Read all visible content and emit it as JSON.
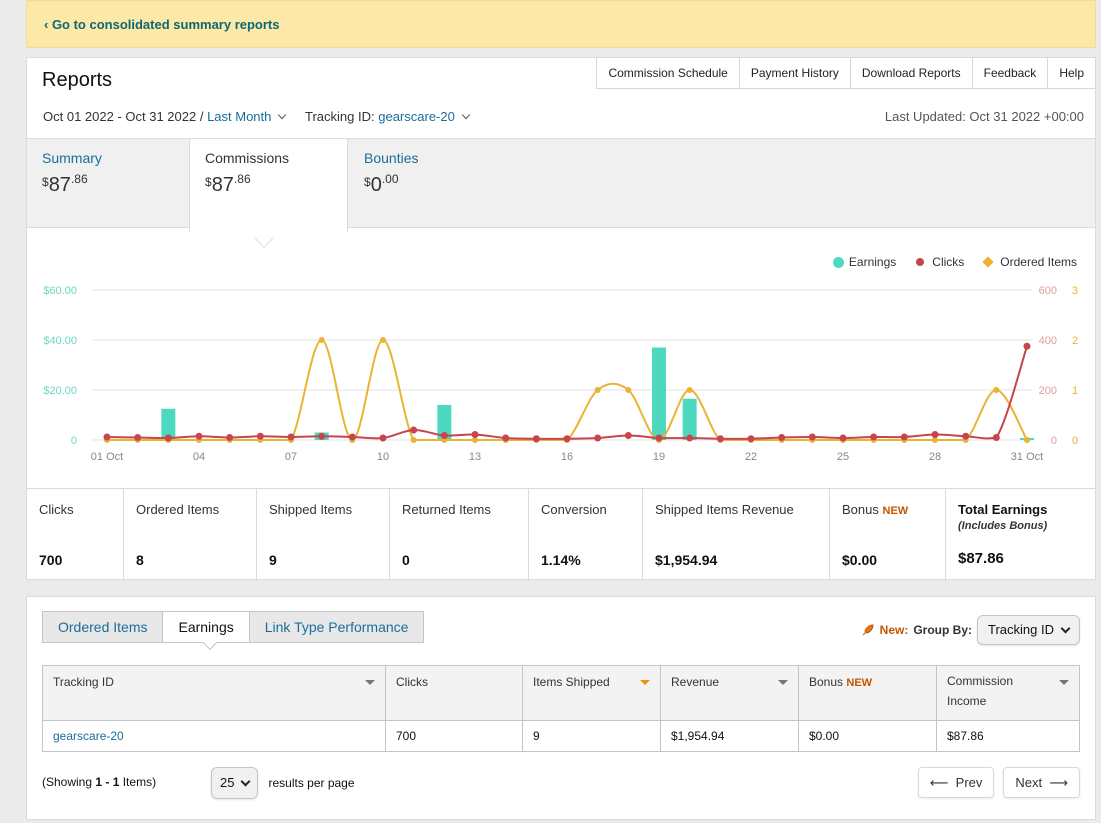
{
  "banner": {
    "link": "‹ Go to consolidated summary reports"
  },
  "header": {
    "title": "Reports",
    "links": [
      "Commission Schedule",
      "Payment History",
      "Download Reports",
      "Feedback",
      "Help"
    ]
  },
  "filters": {
    "date_range": "Oct 01 2022 - Oct 31 2022 /",
    "period": "Last Month",
    "tracking_label": "Tracking ID:",
    "tracking_value": "gearscare-20",
    "last_updated": "Last Updated: Oct 31 2022 +00:00"
  },
  "tabs": [
    {
      "label": "Summary",
      "currency": "$",
      "whole": "87",
      "cents": ".86"
    },
    {
      "label": "Commissions",
      "currency": "$",
      "whole": "87",
      "cents": ".86"
    },
    {
      "label": "Bounties",
      "currency": "$",
      "whole": "0",
      "cents": ".00"
    }
  ],
  "legend": [
    "Earnings",
    "Clicks",
    "Ordered Items"
  ],
  "colors": {
    "earnings": "#4dd9c0",
    "clicks": "#c7454d",
    "ordered": "#eab334",
    "link": "#1a6d9a",
    "new": "#c45500"
  },
  "chart_data": {
    "type": "bar",
    "x": [
      "01 Oct",
      "02",
      "03",
      "04",
      "05",
      "06",
      "07",
      "08",
      "09",
      "10",
      "11",
      "12",
      "13",
      "14",
      "15",
      "16",
      "17",
      "18",
      "19",
      "20",
      "21",
      "22",
      "23",
      "24",
      "25",
      "26",
      "27",
      "28",
      "29",
      "30",
      "31 Oct"
    ],
    "x_tick_labels": [
      "01 Oct",
      "04",
      "07",
      "10",
      "13",
      "16",
      "19",
      "22",
      "25",
      "28",
      "31 Oct"
    ],
    "left_axis": {
      "ticks": [
        "0",
        "$20.00",
        "$40.00",
        "$60.00"
      ],
      "ylim": [
        0,
        60
      ]
    },
    "clicks_axis": {
      "ticks": [
        "0",
        "200",
        "400",
        "600"
      ],
      "ylim": [
        0,
        600
      ]
    },
    "ordered_axis": {
      "ticks": [
        "0",
        "1",
        "2",
        "3"
      ],
      "ylim": [
        0,
        3
      ]
    },
    "series": [
      {
        "name": "Earnings",
        "type": "bar",
        "values": [
          0,
          0,
          12.5,
          0,
          0,
          0,
          0,
          3,
          0,
          0,
          0,
          14,
          0,
          0,
          0,
          0,
          0,
          0,
          37,
          16.5,
          0,
          0,
          0,
          0,
          0,
          0,
          0,
          0,
          0,
          0,
          0.8
        ]
      },
      {
        "name": "Clicks",
        "type": "line",
        "values": [
          12,
          10,
          8,
          15,
          10,
          15,
          12,
          15,
          12,
          8,
          40,
          18,
          22,
          8,
          5,
          5,
          8,
          18,
          8,
          8,
          5,
          5,
          10,
          12,
          8,
          12,
          12,
          22,
          15,
          10,
          375
        ]
      },
      {
        "name": "Ordered Items",
        "type": "line",
        "values": [
          0,
          0,
          0,
          0,
          0,
          0,
          0,
          2,
          0,
          2,
          0,
          0,
          0,
          0,
          0,
          0,
          1,
          1,
          0,
          1,
          0,
          0,
          0,
          0,
          0,
          0,
          0,
          0,
          0,
          1,
          0
        ]
      }
    ],
    "legend_position": "top-right",
    "grid": true
  },
  "stats": [
    {
      "label": "Clicks",
      "value": "700"
    },
    {
      "label": "Ordered Items",
      "value": "8"
    },
    {
      "label": "Shipped Items",
      "value": "9"
    },
    {
      "label": "Returned Items",
      "value": "0"
    },
    {
      "label": "Conversion",
      "value": "1.14%"
    },
    {
      "label": "Shipped Items Revenue",
      "value": "$1,954.94"
    },
    {
      "label": "Bonus",
      "badge": "NEW",
      "value": "$0.00"
    },
    {
      "label": "Total Earnings",
      "sublabel": "(Includes Bonus)",
      "value": "$87.86"
    }
  ],
  "subtabs": [
    "Ordered Items",
    "Earnings",
    "Link Type Performance"
  ],
  "groupby": {
    "new": "New:",
    "label": "Group By:",
    "value": "Tracking ID"
  },
  "table": {
    "headers": [
      "Tracking ID",
      "Clicks",
      "Items Shipped",
      "Revenue",
      "Bonus",
      "Commission Income"
    ],
    "bonus_badge": "NEW",
    "rows": [
      [
        "gearscare-20",
        "700",
        "9",
        "$1,954.94",
        "$0.00",
        "$87.86"
      ]
    ]
  },
  "footer": {
    "showing_pre": "(Showing ",
    "showing_bold": "1 - 1",
    "showing_post": " Items)",
    "per_page": "25",
    "per_page_label": "results per page",
    "prev": "Prev",
    "next": "Next"
  }
}
